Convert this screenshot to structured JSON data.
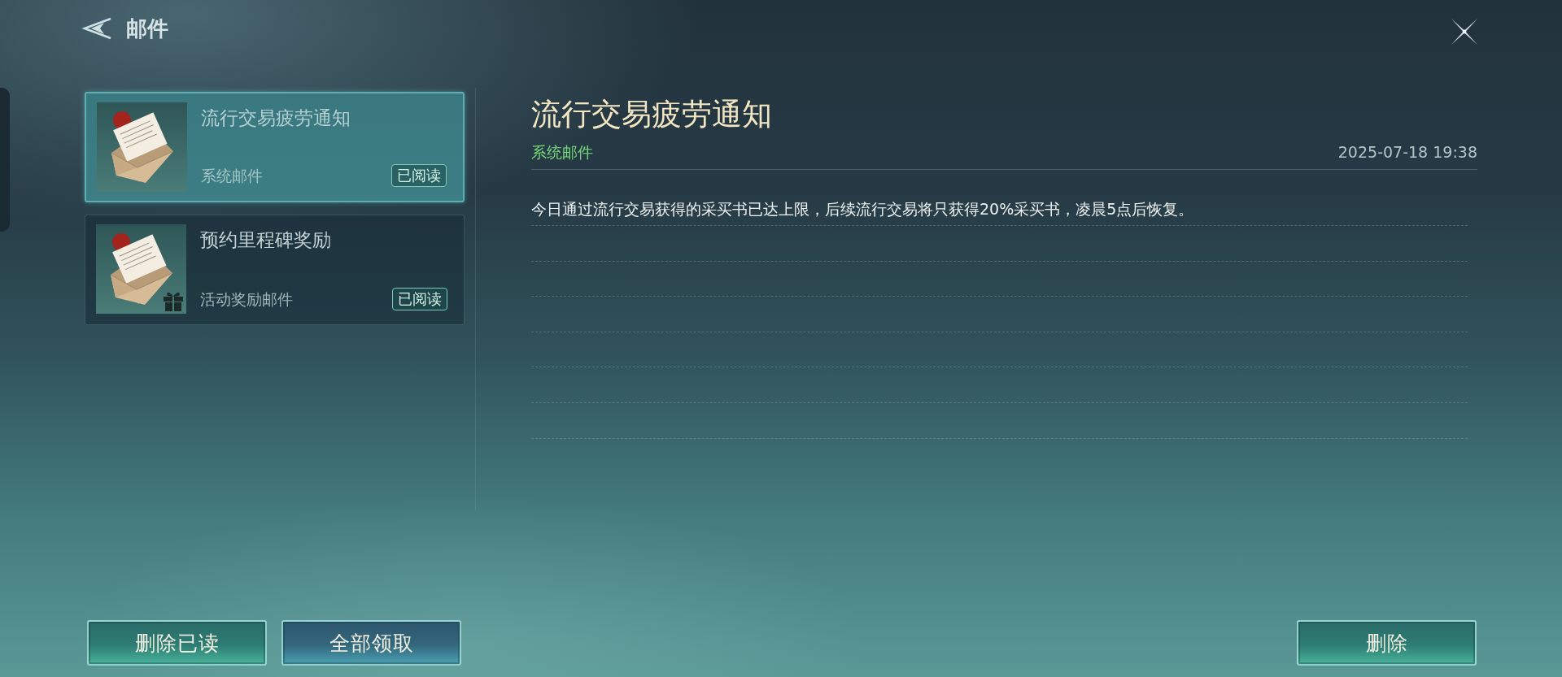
{
  "header": {
    "title": "邮件"
  },
  "mail_list": [
    {
      "title": "流行交易疲劳通知",
      "category": "系统邮件",
      "status": "已阅读",
      "selected": true,
      "has_attachment": false
    },
    {
      "title": "预约里程碑奖励",
      "category": "活动奖励邮件",
      "status": "已阅读",
      "selected": false,
      "has_attachment": true
    }
  ],
  "detail": {
    "title": "流行交易疲劳通知",
    "category": "系统邮件",
    "date": "2025-07-18 19:38",
    "body": "今日通过流行交易获得的采买书已达上限，后续流行交易将只获得20%采买书，凌晨5点后恢复。"
  },
  "list_actions": [
    {
      "label": "删除已读",
      "kind": "delete"
    },
    {
      "label": "全部领取",
      "kind": "claim"
    }
  ],
  "detail_actions": [
    {
      "label": "删除",
      "kind": "delete"
    }
  ]
}
